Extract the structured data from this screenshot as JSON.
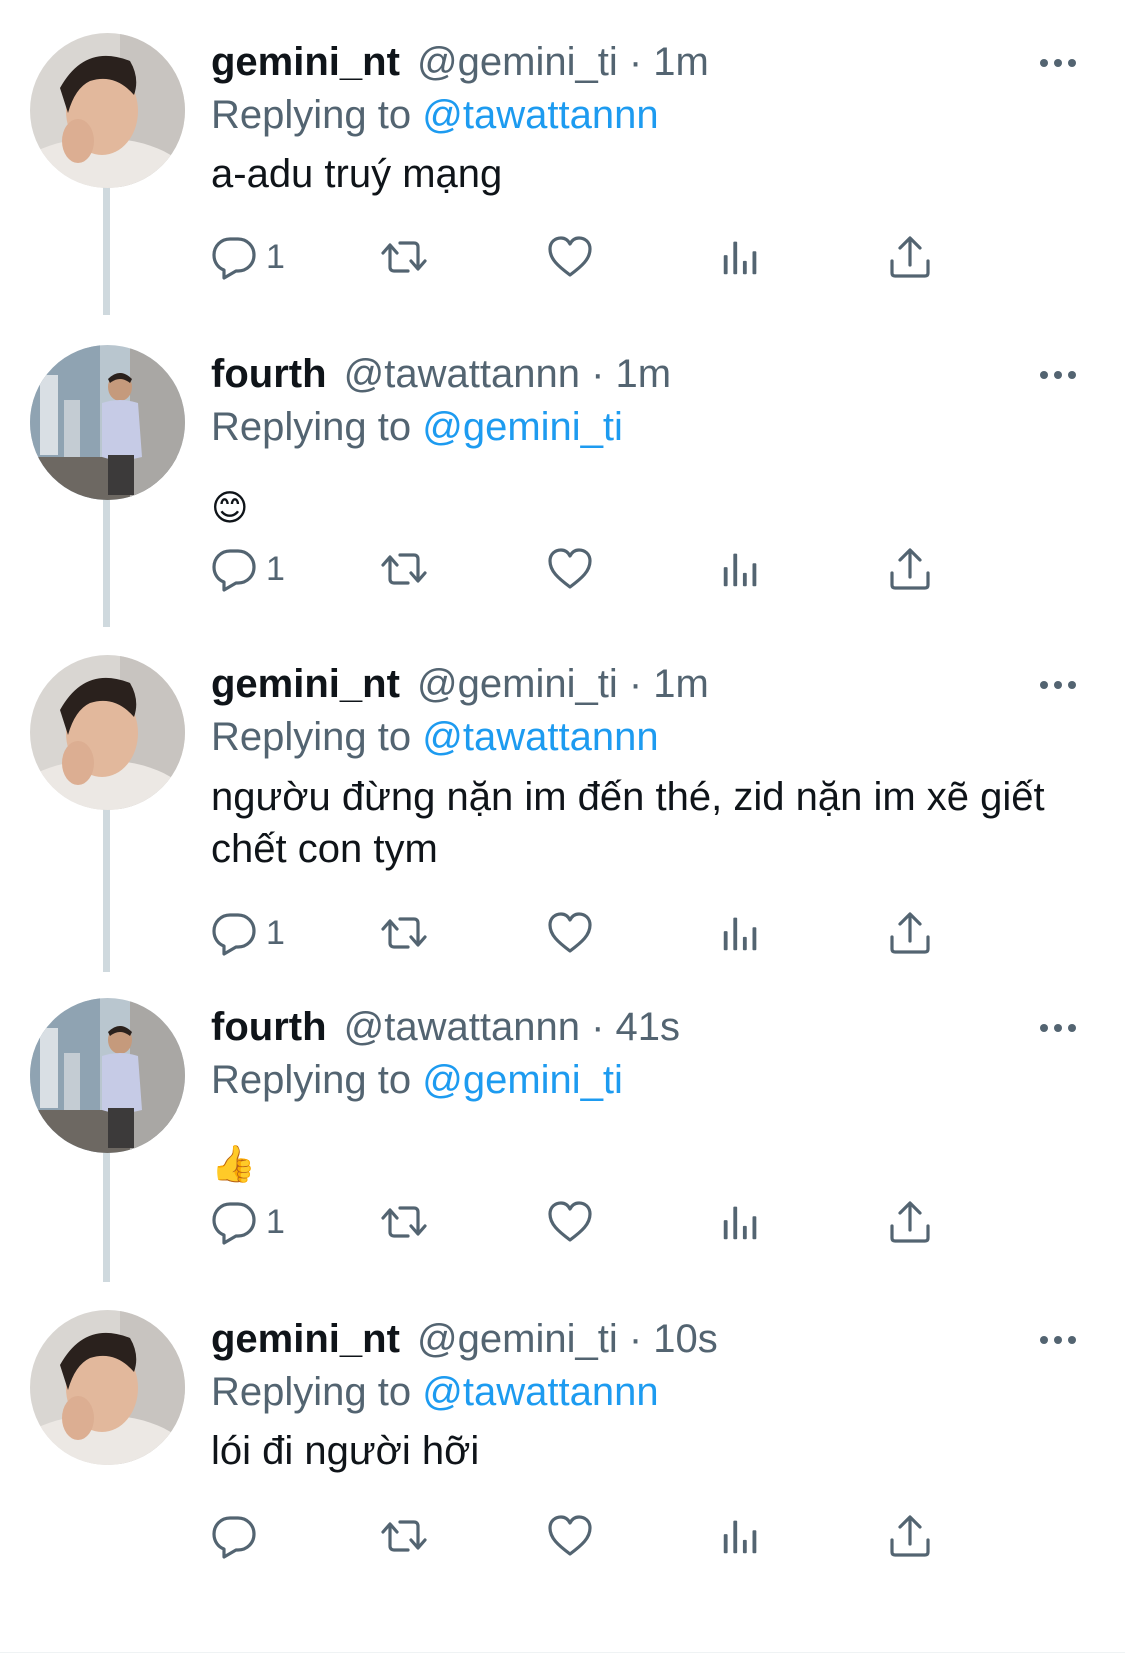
{
  "colors": {
    "link": "#1d9bf0",
    "secondary": "#536471",
    "text": "#0f1419",
    "thread": "#cfd9de"
  },
  "tweets": [
    {
      "name": "gemini_nt",
      "handle": "@gemini_ti",
      "sep": "·",
      "time": "1m",
      "replying_label": "Replying to",
      "replying_to": "@tawattannn",
      "text": "a-adu truý mạng",
      "emoji": "",
      "reply_count": "1",
      "avatar": "gemini-avatar"
    },
    {
      "name": "fourth",
      "handle": "@tawattannn",
      "sep": "·",
      "time": "1m",
      "replying_label": "Replying to",
      "replying_to": "@gemini_ti",
      "text": "",
      "emoji": "😊",
      "reply_count": "1",
      "avatar": "fourth-avatar"
    },
    {
      "name": "gemini_nt",
      "handle": "@gemini_ti",
      "sep": "·",
      "time": "1m",
      "replying_label": "Replying to",
      "replying_to": "@tawattannn",
      "text": "ngườu đừng nặn im đến thé, zid nặn im xẽ giết chết con tym",
      "emoji": "",
      "reply_count": "1",
      "avatar": "gemini-avatar"
    },
    {
      "name": "fourth",
      "handle": "@tawattannn",
      "sep": "·",
      "time": "41s",
      "replying_label": "Replying to",
      "replying_to": "@gemini_ti",
      "text": "",
      "emoji": "👍",
      "reply_count": "1",
      "avatar": "fourth-avatar"
    },
    {
      "name": "gemini_nt",
      "handle": "@gemini_ti",
      "sep": "·",
      "time": "10s",
      "replying_label": "Replying to",
      "replying_to": "@tawattannn",
      "text": "lói đi người hỡi",
      "emoji": "",
      "reply_count": "",
      "avatar": "gemini-avatar"
    }
  ],
  "icons": [
    "reply-icon",
    "retweet-icon",
    "like-icon",
    "analytics-icon",
    "share-icon",
    "more-icon"
  ]
}
